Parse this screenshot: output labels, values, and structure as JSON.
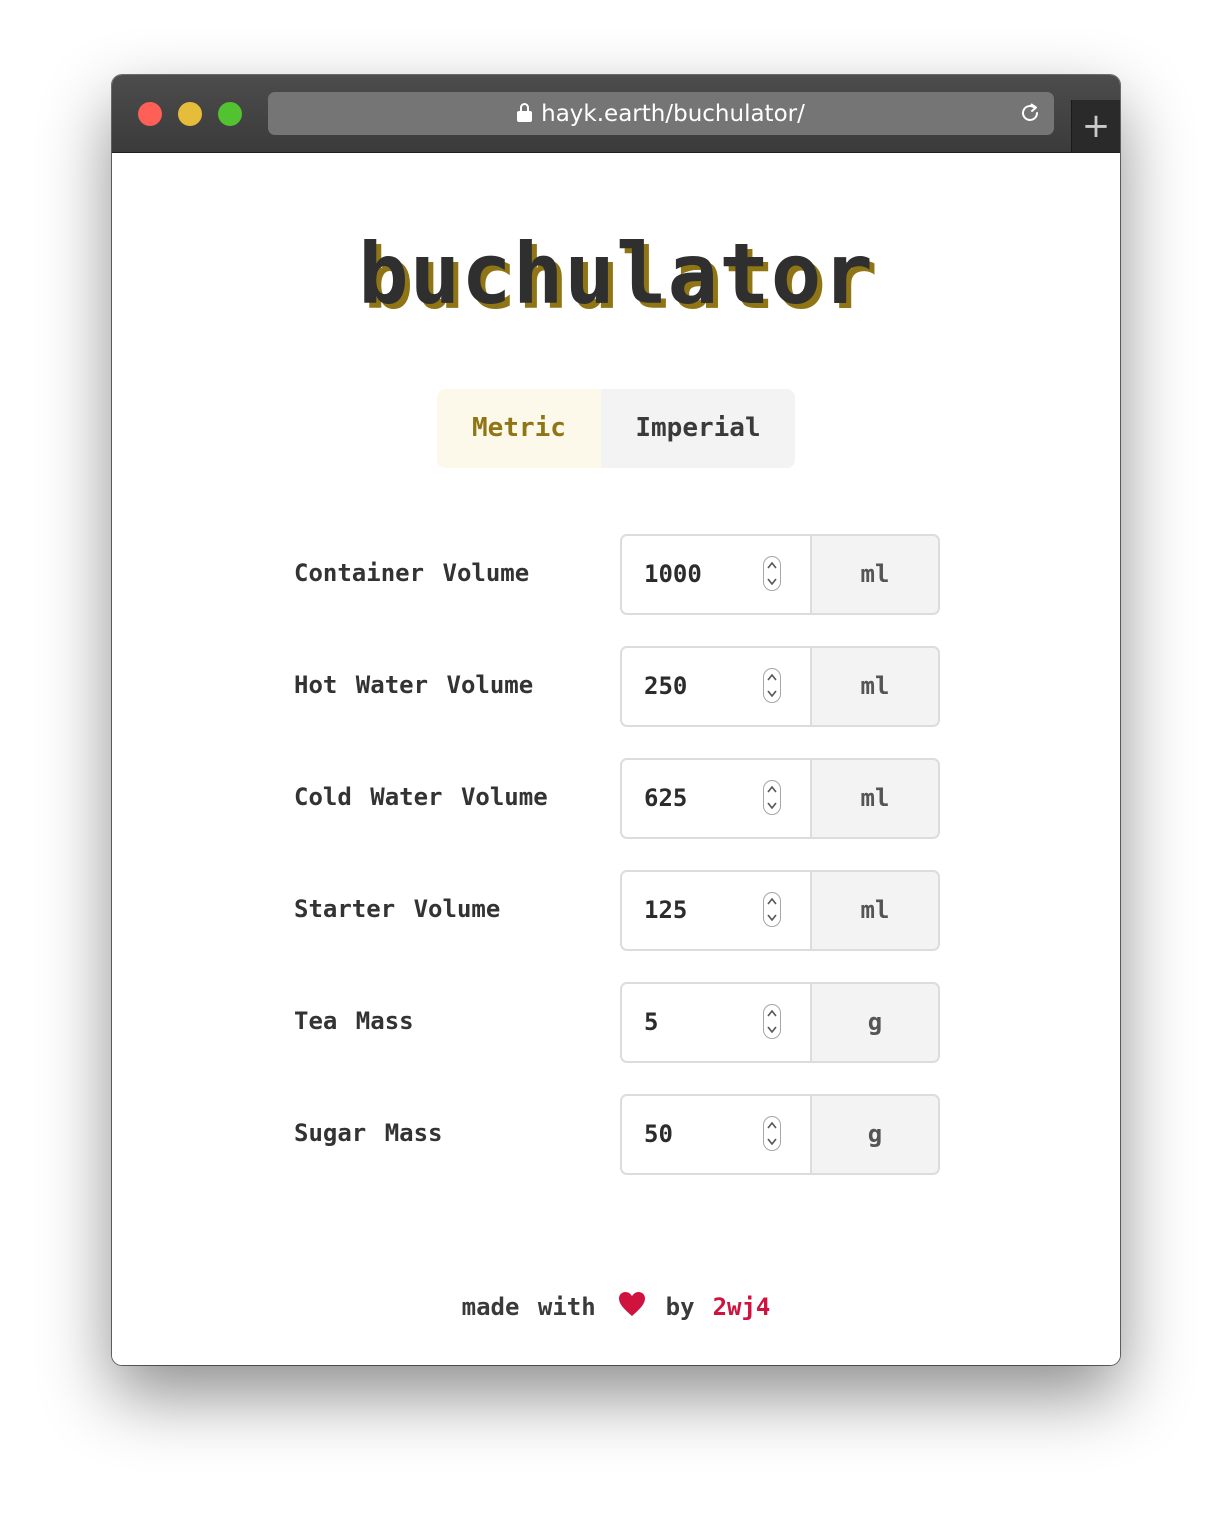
{
  "browser": {
    "url": "hayk.earth/buchulator/",
    "new_tab_label": "+"
  },
  "app": {
    "title": "buchulator"
  },
  "unit_toggle": {
    "selected": "Metric",
    "options": [
      "Metric",
      "Imperial"
    ],
    "metric_label": "Metric",
    "imperial_label": "Imperial"
  },
  "fields": [
    {
      "label": "Container Volume",
      "value": "1000",
      "unit": "ml"
    },
    {
      "label": "Hot Water Volume",
      "value": "250",
      "unit": "ml"
    },
    {
      "label": "Cold Water Volume",
      "value": "625",
      "unit": "ml"
    },
    {
      "label": "Starter Volume",
      "value": "125",
      "unit": "ml"
    },
    {
      "label": "Tea Mass",
      "value": "5",
      "unit": "g"
    },
    {
      "label": "Sugar Mass",
      "value": "50",
      "unit": "g"
    }
  ],
  "footer": {
    "made_with": "made with",
    "by": "by",
    "author": "2wj4"
  },
  "colors": {
    "accent": "#8f7515",
    "heart": "#d0123f",
    "toggle_selected_bg": "#fdf9ea",
    "toggle_unselected_bg": "#f3f3f3"
  },
  "icons": [
    "lock-icon",
    "reload-icon",
    "heart-icon",
    "spinner-arrows-icon"
  ]
}
